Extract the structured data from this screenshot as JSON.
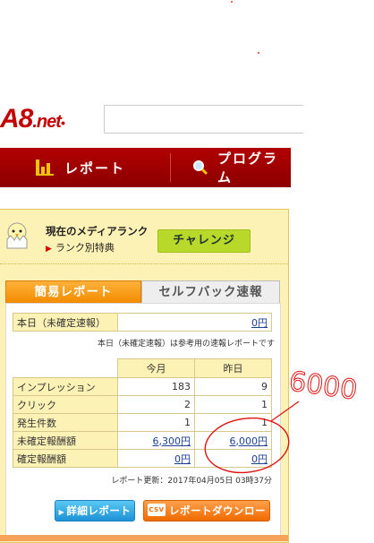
{
  "header": {
    "logo_main": "A8",
    "logo_suffix": ".net"
  },
  "nav": {
    "report": "レポート",
    "program": "プログラム"
  },
  "rank": {
    "title": "現在のメディアランク",
    "benefit": "ランク別特典",
    "challenge": "チャレンジ"
  },
  "tabs": {
    "simple_report": "簡易レポート",
    "selfback": "セルフバック速報"
  },
  "today": {
    "label": "本日（未確定速報）",
    "value": "0円",
    "note": "本日（未確定速報）は参考用の速報レポートです"
  },
  "stats": {
    "headers": [
      "今月",
      "昨日"
    ],
    "rows": [
      {
        "label": "インプレッション",
        "month": "183",
        "yesterday": "9"
      },
      {
        "label": "クリック",
        "month": "2",
        "yesterday": "1"
      },
      {
        "label": "発生件数",
        "month": "1",
        "yesterday": "1"
      },
      {
        "label": "未確定報酬額",
        "month": "6,300円",
        "yesterday": "6,000円"
      },
      {
        "label": "確定報酬額",
        "month": "0円",
        "yesterday": "0円"
      }
    ]
  },
  "updated": "レポート更新：2017年04月05日 03時37分",
  "buttons": {
    "detail": "詳細レポート",
    "csv": "CSV",
    "download": "レポートダウンロード"
  },
  "handwriting": "6000",
  "colors": {
    "brand_red": "#c40000",
    "panel_yellow": "#fdf2b5",
    "tab_orange": "#f28c00",
    "challenge_green": "#b8d92a",
    "annotation_red": "#e01010"
  }
}
